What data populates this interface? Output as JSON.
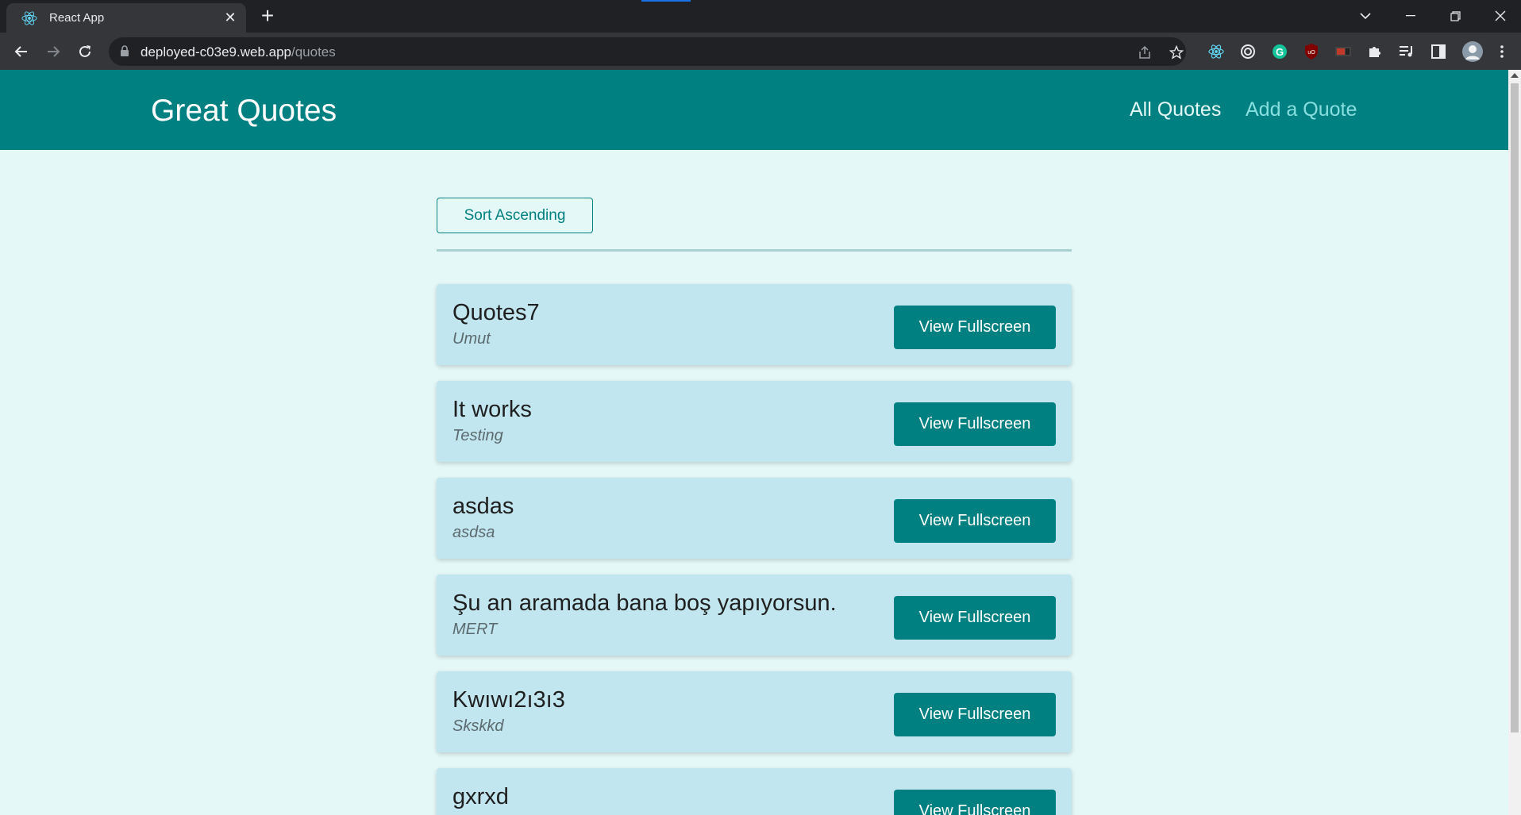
{
  "browser": {
    "tab_title": "React App",
    "url_host": "deployed-c03e9.web.app",
    "url_path": "/quotes"
  },
  "app": {
    "brand": "Great Quotes",
    "nav": {
      "all_quotes": "All Quotes",
      "add_quote": "Add a Quote"
    },
    "sort_label": "Sort Ascending",
    "view_label": "View Fullscreen",
    "colors": {
      "primary": "#008080",
      "background": "#e4f8f8",
      "card": "#c2e6ef",
      "active_nav": "#e4f8f8",
      "inactive_nav": "#88dfdf"
    }
  },
  "quotes": [
    {
      "text": "Quotes7",
      "author": "Umut"
    },
    {
      "text": "It works",
      "author": "Testing"
    },
    {
      "text": "asdas",
      "author": "asdsa"
    },
    {
      "text": "Şu an aramada bana boş yapıyorsun.",
      "author": "MERT"
    },
    {
      "text": "Kwıwı2ı3ı3",
      "author": "Skskkd"
    },
    {
      "text": "gxrxd",
      "author": ""
    }
  ]
}
